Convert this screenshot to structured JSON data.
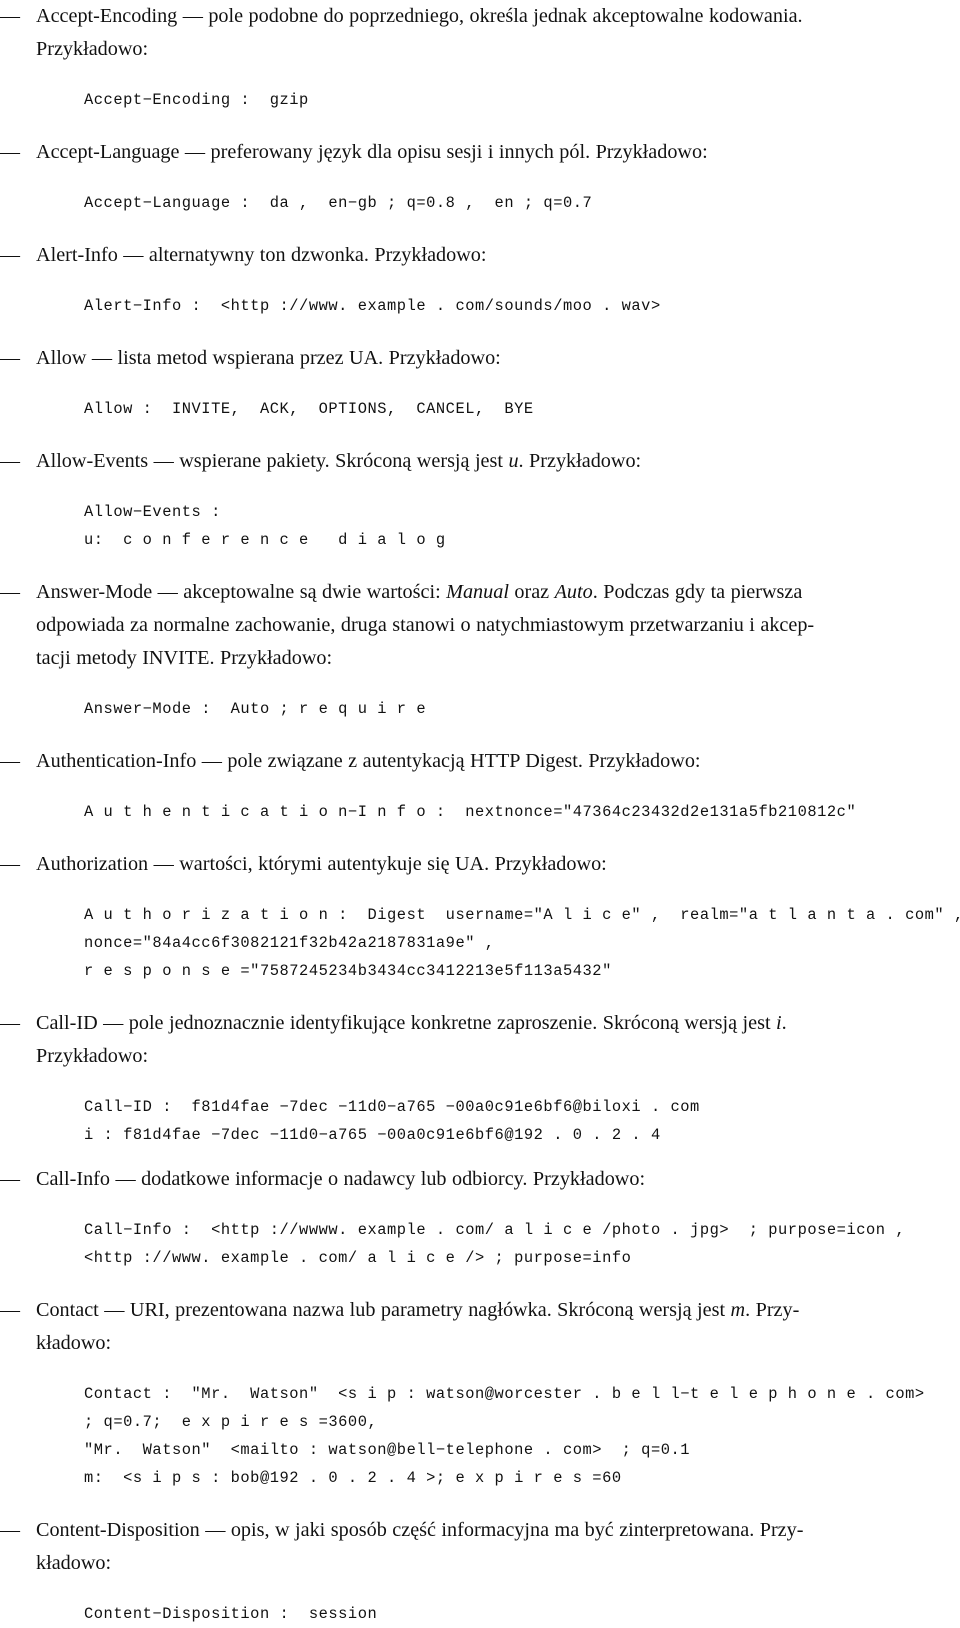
{
  "document": {
    "language": "pl",
    "bullet_glyph": "—",
    "emdash": "—",
    "example_word": "Przykładowo:",
    "example_word_hyphenated_1": "Przy-",
    "example_word_hyphenated_2": "kładowo:"
  },
  "entries": [
    {
      "id": "accept-encoding",
      "name": "Accept-Encoding",
      "paragraph_html": "Accept-Encoding — pole podobne do poprzedniego, określa jednak akceptowalne kodowania. Przykładowo:",
      "code_lines": [
        "Accept-Encoding :   gzip"
      ]
    },
    {
      "id": "accept-language",
      "name": "Accept-Language",
      "paragraph_html": "Accept-Language — preferowany język dla opisu sesji i innych pól. Przykładowo:",
      "code_lines": [
        "Accept-Language :   da ,   en-gb ; q=0.8 ,   en ; q=0.7"
      ]
    },
    {
      "id": "alert-info",
      "name": "Alert-Info",
      "paragraph_html": "Alert-Info — alternatywny ton dzwonka. Przykładowo:",
      "code_lines": [
        "Alert-Info :   <http ://www. example . com/sounds/moo . wav>"
      ]
    },
    {
      "id": "allow",
      "name": "Allow",
      "paragraph_html": "Allow — lista metod wspierana przez UA. Przykładowo:",
      "code_lines": [
        "Allow :   INVITE,   ACK,   OPTIONS,   CANCEL,   BYE"
      ]
    },
    {
      "id": "allow-events",
      "name": "Allow-Events",
      "paragraph_html": "Allow-Events — wspierane pakiety. Skróconą wersją jest <i>u</i>. Przykładowo:",
      "code_lines": [
        "Allow-Events :",
        "u:   c o n f e r e n c e   d i a l o g"
      ]
    },
    {
      "id": "answer-mode",
      "name": "Answer-Mode",
      "paragraph_html": "Answer-Mode — akceptowalne są dwie wartości: <i>Manual</i> oraz <i>Auto</i>. Podczas gdy ta pierwsza odpowiada za normalne zachowanie, druga stanowi o natychmiastowym przetwarzaniu i akcep-tacji metody INVITE. Przykładowo:",
      "code_lines": [
        "Answer-Mode :   Auto ; r e q u i r e"
      ]
    },
    {
      "id": "authentication-info",
      "name": "Authentication-Info",
      "paragraph_html": "Authentication-Info — pole związane z autentykacją HTTP Digest. Przykładowo:",
      "code_lines": [
        "A u t h e n t i c a t i o n-I n f o :   nextnonce=\"47364c23432d2e131a5fb210812c\""
      ]
    },
    {
      "id": "authorization",
      "name": "Authorization",
      "paragraph_html": "Authorization — wartości, którymi autentykuje się UA. Przykładowo:",
      "code_lines": [
        "A u t h o r i z a t i o n :   Digest   username=\"A l i c e\" ,   realm=\"a t l a n t a . com\" ,",
        "nonce=\"84a4cc6f3082121f32b42a2187831a9e\" ,",
        "r e s p o n s e =\"7587245234b3434cc3412213e5f113a5432\""
      ]
    },
    {
      "id": "call-id",
      "name": "Call-ID",
      "paragraph_html": "Call-ID — pole jednoznacznie identyfikujące konkretne zaproszenie. Skróconą wersją jest <i>i</i>. Przykładowo:",
      "code_lines": [
        "Call-ID :   f81d4fae-7dec-11d0-a765-00a0c91e6bf6@biloxi . com",
        "i : f81d4fae-7dec-11d0-a765-00a0c91e6bf6@192 . 0 . 2 . 4"
      ]
    },
    {
      "id": "call-info",
      "name": "Call-Info",
      "paragraph_html": "Call-Info — dodatkowe informacje o nadawcy lub odbiorcy. Przykładowo:",
      "code_lines": [
        "Call-Info :   <http ://wwww. example . com/ a l i c e /photo . jpg>   ; purpose=icon ,",
        "<http ://www. example . com/ a l i c e /> ; purpose=info"
      ]
    },
    {
      "id": "contact",
      "name": "Contact",
      "paragraph_html": "Contact — URI, prezentowana nazwa lub parametry nagłówka. Skróconą wersją jest <i>m</i>. Przy-kładowo:",
      "code_lines": [
        "Contact :   \"Mr.   Watson\"   <s i p : watson@worcester . b e l l-t e l e p h o n e . com>",
        "; q=0.7;   e x p i r e s =3600,",
        "\"Mr.   Watson\"   <mailto : watson@bell-telephone . com>   ; q=0.1",
        "m:   <s i p s : bob@192 . 0 . 2 . 4 >; e x p i r e s =60"
      ]
    },
    {
      "id": "content-disposition",
      "name": "Content-Disposition",
      "paragraph_html": "Content-Disposition — opis, w jaki sposób część informacyjna ma być zinterpretowana. Przy-kładowo:",
      "code_lines": [
        "Content-Disposition :   session"
      ]
    }
  ],
  "rendered_lines": {
    "accept_encoding_line1": "Accept-Encoding — pole podobne do poprzedniego, określa jednak akceptowalne kodowania.",
    "accept_encoding_line2": "Przykładowo:",
    "accept_encoding_code": "Accept−Encoding :  gzip",
    "accept_language_line1": "Accept-Language — preferowany język dla opisu sesji i innych pól. Przykładowo:",
    "accept_language_code": "Accept−Language :  da ,  en−gb ; q=0.8 ,  en ; q=0.7",
    "alert_info_line1": "Alert-Info — alternatywny ton dzwonka. Przykładowo:",
    "alert_info_code": "Alert−Info :  <http ://www. example . com/sounds/moo . wav>",
    "allow_line1": "Allow — lista metod wspierana przez UA. Przykładowo:",
    "allow_code": "Allow :  INVITE,  ACK,  OPTIONS,  CANCEL,  BYE",
    "allow_events_line1_a": "Allow-Events — wspierane pakiety. Skróconą wersją jest ",
    "allow_events_line1_i": "u",
    "allow_events_line1_b": ". Przykładowo:",
    "allow_events_code1": "Allow−Events :",
    "allow_events_code2": "u:  c o n f e r e n c e   d i a l o g",
    "answer_mode_line1_a": "Answer-Mode — akceptowalne są dwie wartości: ",
    "answer_mode_line1_i1": "Manual",
    "answer_mode_line1_b": " oraz ",
    "answer_mode_line1_i2": "Auto",
    "answer_mode_line1_c": ". Podczas gdy ta pierwsza",
    "answer_mode_line2": "odpowiada za normalne zachowanie, druga stanowi o natychmiastowym przetwarzaniu i akcep-",
    "answer_mode_line3": "tacji metody INVITE. Przykładowo:",
    "answer_mode_code": "Answer−Mode :  Auto ; r e q u i r e",
    "authentication_info_line1": "Authentication-Info — pole związane z autentykacją HTTP Digest. Przykładowo:",
    "authentication_info_code": "A u t h e n t i c a t i o n−I n f o :  nextnonce=\"47364c23432d2e131a5fb210812c\"",
    "authorization_line1": "Authorization — wartości, którymi autentykuje się UA. Przykładowo:",
    "authorization_code1": "A u t h o r i z a t i o n :  Digest  username=\"A l i c e\" ,  realm=\"a t l a n t a . com\" ,",
    "authorization_code2": "nonce=\"84a4cc6f3082121f32b42a2187831a9e\" ,",
    "authorization_code3": "r e s p o n s e =\"7587245234b3434cc3412213e5f113a5432\"",
    "call_id_line1_a": "Call-ID — pole jednoznacznie identyfikujące konkretne zaproszenie. Skróconą wersją jest ",
    "call_id_line1_i": "i",
    "call_id_line1_b": ".",
    "call_id_line2": "Przykładowo:",
    "call_id_code1": "Call−ID :  f81d4fae −7dec −11d0−a765 −00a0c91e6bf6@biloxi . com",
    "call_id_code2": "i : f81d4fae −7dec −11d0−a765 −00a0c91e6bf6@192 . 0 . 2 . 4",
    "call_info_line1": "Call-Info — dodatkowe informacje o nadawcy lub odbiorcy. Przykładowo:",
    "call_info_code1": "Call−Info :  <http ://wwww. example . com/ a l i c e /photo . jpg>  ; purpose=icon ,",
    "call_info_code2": "<http ://www. example . com/ a l i c e /> ; purpose=info",
    "contact_line1_a": "Contact — URI, prezentowana nazwa lub parametry nagłówka. Skróconą wersją jest ",
    "contact_line1_i": "m",
    "contact_line1_b": ". Przy-",
    "contact_line2": "kładowo:",
    "contact_code1": "Contact :  \"Mr.  Watson\"  <s i p : watson@worcester . b e l l−t e l e p h o n e . com>",
    "contact_code2": "; q=0.7;  e x p i r e s =3600,",
    "contact_code3": "\"Mr.  Watson\"  <mailto : watson@bell−telephone . com>  ; q=0.1",
    "contact_code4": "m:  <s i p s : bob@192 . 0 . 2 . 4 >; e x p i r e s =60",
    "content_disposition_line1": "Content-Disposition — opis, w jaki sposób część informacyjna ma być zinterpretowana. Przy-",
    "content_disposition_line2": "kładowo:",
    "content_disposition_code": "Content−Disposition :  session"
  }
}
